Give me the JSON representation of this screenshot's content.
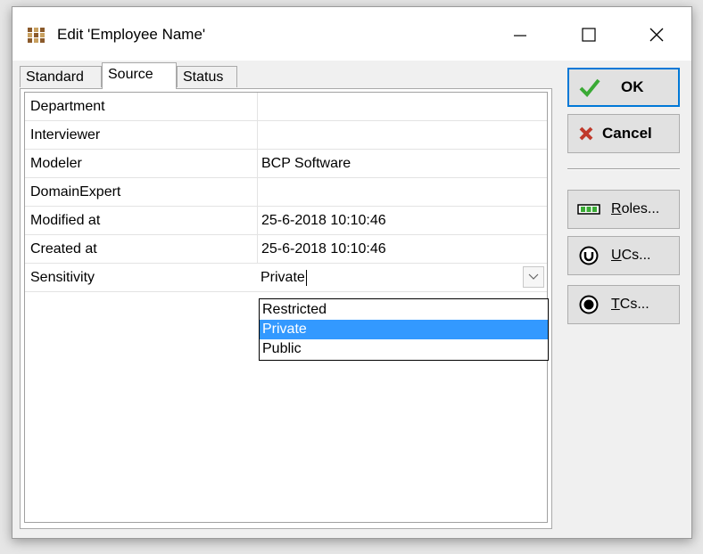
{
  "window": {
    "title": "Edit 'Employee Name'"
  },
  "tabs": [
    {
      "label": "Standard",
      "active": false
    },
    {
      "label": "Source",
      "active": true
    },
    {
      "label": "Status",
      "active": false
    }
  ],
  "properties": [
    {
      "label": "Department",
      "value": ""
    },
    {
      "label": "Interviewer",
      "value": ""
    },
    {
      "label": "Modeler",
      "value": "BCP Software"
    },
    {
      "label": "DomainExpert",
      "value": ""
    },
    {
      "label": "Modified at",
      "value": "25-6-2018 10:10:46"
    },
    {
      "label": "Created at",
      "value": "25-6-2018 10:10:46"
    },
    {
      "label": "Sensitivity",
      "value": "Private"
    }
  ],
  "sensitivity_dropdown": {
    "options": [
      "Restricted",
      "Private",
      "Public"
    ],
    "selected": "Private"
  },
  "buttons": {
    "ok": "OK",
    "cancel": "Cancel",
    "roles_accel": "R",
    "roles_rest": "oles...",
    "ucs_accel": "U",
    "ucs_rest": "Cs...",
    "tcs_accel": "T",
    "tcs_rest": "Cs..."
  },
  "colors": {
    "selection": "#3399ff",
    "default_button_border": "#0078d7",
    "ok_check": "#3aaa35",
    "cancel_x": "#c0392b"
  },
  "icons": {
    "app": "app-grid-icon",
    "ok": "check-icon",
    "cancel": "x-icon",
    "roles": "roles-icon",
    "ucs": "use-case-icon",
    "tcs": "test-case-icon"
  }
}
